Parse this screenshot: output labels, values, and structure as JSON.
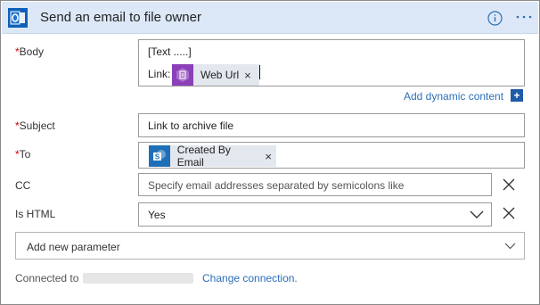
{
  "header": {
    "title": "Send an email to file owner",
    "app_icon": "outlook-icon",
    "info_icon": "info-icon",
    "more_icon": "ellipsis-icon",
    "background": "#dce8f7"
  },
  "body_field": {
    "label": "Body",
    "line1": "[Text .....]",
    "link_prefix": "Link:",
    "token": {
      "label": "Web Url",
      "icon": "document-icon",
      "color": "#8b3fb8"
    }
  },
  "add_dynamic_content": {
    "label": "Add dynamic content",
    "icon": "plus-icon"
  },
  "subject_field": {
    "label": "Subject",
    "value": "Link to archive file"
  },
  "to_field": {
    "label": "To",
    "token": {
      "label": "Created By Email",
      "icon": "sharepoint-icon",
      "color": "#1f6fb8"
    }
  },
  "cc_field": {
    "label": "CC",
    "placeholder": "Specify email addresses separated by semicolons like"
  },
  "is_html_field": {
    "label": "Is HTML",
    "value": "Yes"
  },
  "add_new_parameter": {
    "label": "Add new parameter"
  },
  "connection": {
    "label": "Connected to",
    "change_link": "Change connection."
  },
  "required_marker": "*",
  "colors": {
    "link": "#2c6fb8",
    "required": "#cc0000"
  }
}
